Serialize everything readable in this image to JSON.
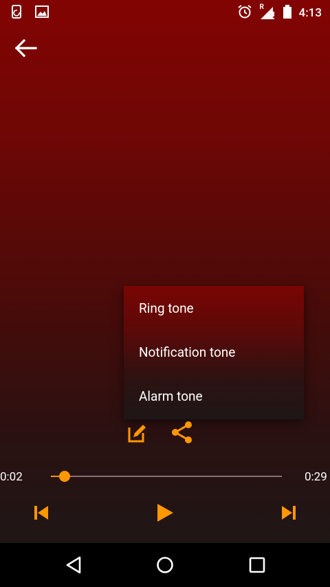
{
  "status_bar": {
    "time": "4:13",
    "roaming_indicator": "R",
    "icons": [
      "phone-sync-icon",
      "image-icon",
      "alarm-icon",
      "signal-icon",
      "battery-icon"
    ]
  },
  "colors": {
    "accent": "#ff9800",
    "background_top": "#820402",
    "background_bottom": "#1f1616",
    "menu_text": "#ffffff"
  },
  "header": {
    "back_icon": "arrow-back-icon"
  },
  "popup_menu": {
    "items": [
      {
        "label": "Ring tone"
      },
      {
        "label": "Notification tone"
      },
      {
        "label": "Alarm tone"
      }
    ]
  },
  "actions": {
    "icons": [
      "edit-icon",
      "share-icon"
    ]
  },
  "player": {
    "elapsed": "0:02",
    "duration": "0:29",
    "progress_fraction": 0.06,
    "controls": [
      "skip-previous-icon",
      "play-icon",
      "skip-next-icon"
    ]
  },
  "nav_bar": {
    "icons": [
      "back-triangle-icon",
      "home-circle-icon",
      "recents-square-icon"
    ]
  }
}
